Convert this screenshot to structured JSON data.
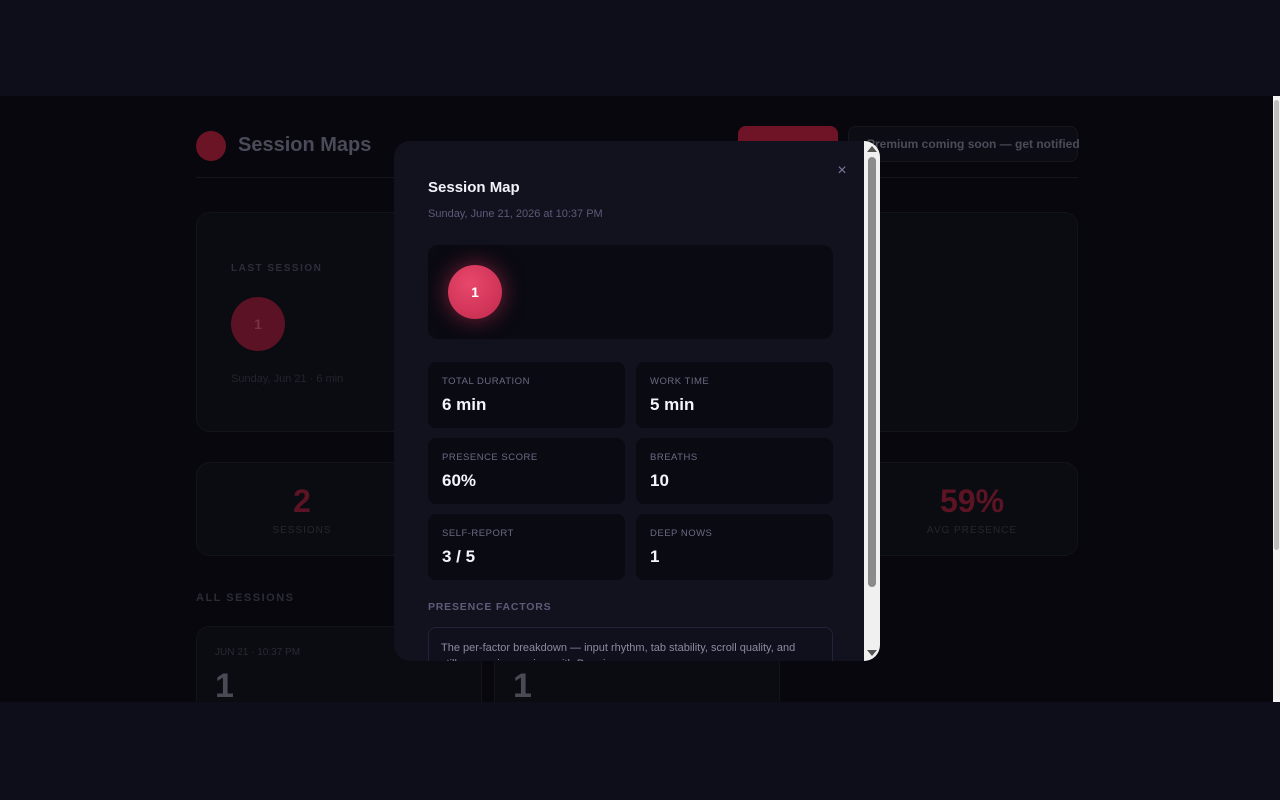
{
  "app": {
    "title": "Session Maps",
    "premium_text": "Premium coming soon — get notified",
    "last_session": {
      "label": "LAST SESSION",
      "bubble": "1",
      "meta": "Sunday, Jun 21 · 6 min"
    },
    "stats": [
      {
        "value": "2",
        "label": "SESSIONS"
      },
      {
        "value": "59%",
        "label": "AVG PRESENCE"
      }
    ],
    "all_sessions_label": "ALL SESSIONS",
    "session_cards": [
      {
        "date": "JUN 21 · 10:37 PM",
        "value": "1"
      },
      {
        "date": "",
        "value": "1"
      }
    ]
  },
  "modal": {
    "title": "Session Map",
    "date": "Sunday, June 21, 2026 at 10:37 PM",
    "close_icon": "×",
    "map_node": "1",
    "stats": [
      {
        "label": "TOTAL DURATION",
        "value": "6 min"
      },
      {
        "label": "WORK TIME",
        "value": "5 min"
      },
      {
        "label": "PRESENCE SCORE",
        "value": "60%"
      },
      {
        "label": "BREATHS",
        "value": "10"
      },
      {
        "label": "SELF-REPORT",
        "value": "3 / 5"
      },
      {
        "label": "DEEP NOWS",
        "value": "1"
      }
    ],
    "presence_factors_label": "PRESENCE FACTORS",
    "presence_factors_text": "The per-factor breakdown — input rhythm, tab stability, scroll quality, and stillness — is premium with Premium."
  },
  "colors": {
    "accent": "#e03a5e",
    "modal_bg": "#12121f",
    "page_bg": "#0e0e1a"
  }
}
